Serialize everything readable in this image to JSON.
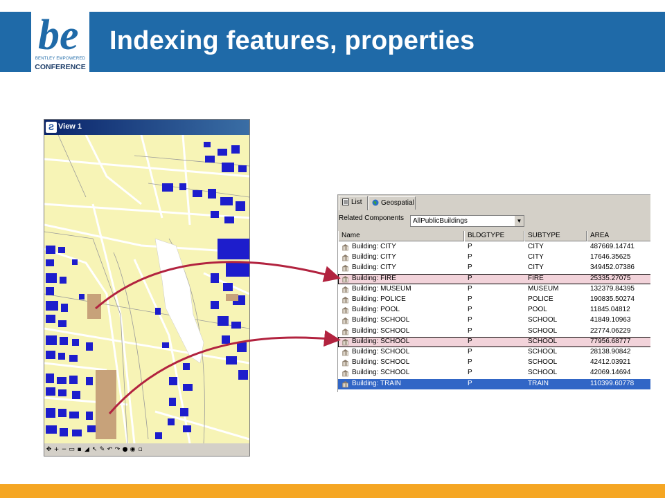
{
  "slide": {
    "title": "Indexing features, properties",
    "logo_small_text": "BENTLEY EMPOWERED",
    "logo_conference": "CONFERENCE",
    "logo_letters": "be",
    "colors": {
      "header": "#1f6aa8",
      "footer": "#f5a623",
      "arrow": "#b2233f"
    }
  },
  "map_window": {
    "title": "View 1",
    "icon": "app-icon",
    "toolbar_icons": [
      "pan-icon",
      "zoom-in-icon",
      "zoom-out-icon",
      "zoom-window-icon",
      "fit-icon",
      "measure-icon",
      "select-icon",
      "edit-icon",
      "undo-icon",
      "redo-icon",
      "stop-icon",
      "settings-icon",
      "refresh-icon"
    ]
  },
  "panel": {
    "tabs": [
      {
        "label": "List",
        "icon": "list-icon"
      },
      {
        "label": "Geospatial",
        "icon": "globe-icon"
      }
    ],
    "related_label": "Related Components",
    "related_value": "AllPublicBuildings",
    "columns": [
      "Name",
      "BLDGTYPE",
      "SUBTYPE",
      "AREA"
    ],
    "rows": [
      {
        "name": "Building: CITY",
        "bldgtype": "P",
        "subtype": "CITY",
        "area": "487669.14741",
        "state": ""
      },
      {
        "name": "Building: CITY",
        "bldgtype": "P",
        "subtype": "CITY",
        "area": "17646.35625",
        "state": ""
      },
      {
        "name": "Building: CITY",
        "bldgtype": "P",
        "subtype": "CITY",
        "area": "349452.07386",
        "state": ""
      },
      {
        "name": "Building: FIRE",
        "bldgtype": "P",
        "subtype": "FIRE",
        "area": "25335.27075",
        "state": "highlight"
      },
      {
        "name": "Building: MUSEUM",
        "bldgtype": "P",
        "subtype": "MUSEUM",
        "area": "132379.84395",
        "state": ""
      },
      {
        "name": "Building: POLICE",
        "bldgtype": "P",
        "subtype": "POLICE",
        "area": "190835.50274",
        "state": ""
      },
      {
        "name": "Building: POOL",
        "bldgtype": "P",
        "subtype": "POOL",
        "area": "11845.04812",
        "state": ""
      },
      {
        "name": "Building: SCHOOL",
        "bldgtype": "P",
        "subtype": "SCHOOL",
        "area": "41849.10963",
        "state": ""
      },
      {
        "name": "Building: SCHOOL",
        "bldgtype": "P",
        "subtype": "SCHOOL",
        "area": "22774.06229",
        "state": ""
      },
      {
        "name": "Building: SCHOOL",
        "bldgtype": "P",
        "subtype": "SCHOOL",
        "area": "77956.68777",
        "state": "highlight"
      },
      {
        "name": "Building: SCHOOL",
        "bldgtype": "P",
        "subtype": "SCHOOL",
        "area": "28138.90842",
        "state": ""
      },
      {
        "name": "Building: SCHOOL",
        "bldgtype": "P",
        "subtype": "SCHOOL",
        "area": "42412.03921",
        "state": ""
      },
      {
        "name": "Building: SCHOOL",
        "bldgtype": "P",
        "subtype": "SCHOOL",
        "area": "42069.14694",
        "state": ""
      },
      {
        "name": "Building: TRAIN",
        "bldgtype": "P",
        "subtype": "TRAIN",
        "area": "110399.60778",
        "state": "selected"
      }
    ]
  }
}
